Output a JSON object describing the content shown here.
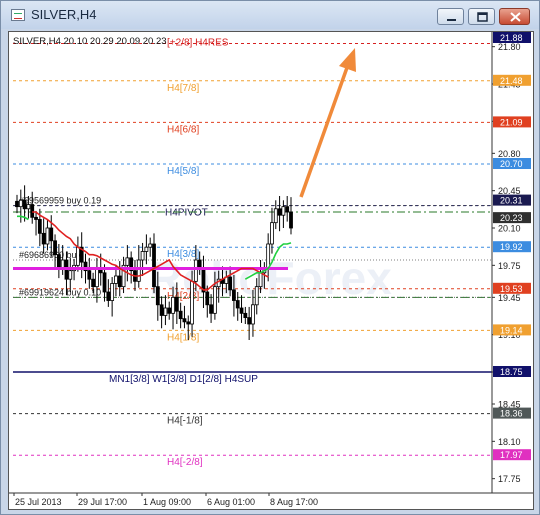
{
  "window": {
    "title": "SILVER,H4",
    "buttons": {
      "minimize": "minimize-icon",
      "maximize": "maximize-icon",
      "close": "close-icon"
    }
  },
  "chart_data": {
    "type": "candlestick",
    "symbol_header": "SILVER,H4  20.10 20.29 20.09 20.23",
    "ylim": [
      17.7,
      21.9
    ],
    "y_ticks": [
      "21.80",
      "21.45",
      "21.10",
      "20.80",
      "20.45",
      "20.10",
      "19.75",
      "19.45",
      "19.10",
      "18.75",
      "18.45",
      "18.10",
      "17.75"
    ],
    "x_ticks": [
      "25 Jul 2013",
      "29 Jul 17:00",
      "1 Aug 09:00",
      "6 Aug 01:00",
      "8 Aug 17:00"
    ],
    "watermark": "RoboForex",
    "levels": [
      {
        "label": "[+2/8] H4RES",
        "value": 21.83,
        "color": "#d62020",
        "style": "dash"
      },
      {
        "label": "H4[7/8]",
        "value": 21.48,
        "color": "#f0a030",
        "style": "dash"
      },
      {
        "label": "H4[6/8]",
        "value": 21.09,
        "color": "#e04020",
        "style": "dash"
      },
      {
        "label": "H4[5/8]",
        "value": 20.7,
        "color": "#3c8ce0",
        "style": "dash"
      },
      {
        "label": "H4PIVOT",
        "value": 20.31,
        "color": "#1a1a50",
        "style": "dash"
      },
      {
        "label": "H4[3/8]",
        "value": 19.92,
        "color": "#3c8ce0",
        "style": "dash"
      },
      {
        "label": "H4[2/8]",
        "value": 19.53,
        "color": "#e04020",
        "style": "dash"
      },
      {
        "label": "H4[1/8]",
        "value": 19.14,
        "color": "#f0a030",
        "style": "dash"
      },
      {
        "label": "MN1[3/8] W1[3/8] D1[2/8] H4SUP",
        "value": 18.75,
        "color": "#10106a",
        "style": "solid"
      },
      {
        "label": "H4[-1/8]",
        "value": 18.36,
        "color": "#333333",
        "style": "dash"
      },
      {
        "label": "H4[-2/8]",
        "value": 17.97,
        "color": "#e030c0",
        "style": "dash"
      }
    ],
    "price_badges": [
      {
        "text": "21.88",
        "color": "#10106a"
      },
      {
        "text": "21.48",
        "color": "#f0a030"
      },
      {
        "text": "21.09",
        "color": "#e04020"
      },
      {
        "text": "20.70",
        "color": "#3c8ce0"
      },
      {
        "text": "20.31",
        "color": "#1a1a50"
      },
      {
        "text": "20.23",
        "color": "#303030"
      },
      {
        "text": "19.92",
        "color": "#3c8ce0"
      },
      {
        "text": "19.53",
        "color": "#e04020"
      },
      {
        "text": "19.14",
        "color": "#f0a030"
      },
      {
        "text": "18.75",
        "color": "#10106a"
      },
      {
        "text": "18.36",
        "color": "#505858"
      },
      {
        "text": "17.97",
        "color": "#e030c0"
      }
    ],
    "orders": [
      {
        "label": "#69569959 buy 0.19",
        "value": 20.31
      },
      {
        "label": "#69686960 buy",
        "value": 19.8
      },
      {
        "label": "#69919624 buy 0.10",
        "value": 19.45
      }
    ],
    "magenta_level": 19.72,
    "dashdot_levels": [
      20.25,
      19.45
    ],
    "close_series": [
      20.3,
      20.36,
      20.28,
      20.32,
      20.2,
      20.18,
      20.05,
      19.95,
      20.1,
      19.98,
      19.85,
      19.72,
      19.8,
      19.62,
      19.7,
      19.75,
      19.92,
      19.78,
      19.7,
      19.62,
      19.55,
      19.72,
      19.68,
      19.5,
      19.42,
      19.58,
      19.65,
      19.55,
      19.75,
      19.82,
      19.7,
      19.6,
      19.8,
      19.88,
      19.92,
      19.95,
      19.55,
      19.38,
      19.28,
      19.35,
      19.3,
      19.45,
      19.32,
      19.25,
      19.22,
      19.2,
      19.6,
      19.8,
      19.72,
      19.5,
      19.38,
      19.3,
      19.55,
      19.62,
      19.58,
      19.64,
      19.52,
      19.42,
      19.35,
      19.3,
      19.26,
      19.2,
      19.38,
      19.55,
      19.68,
      19.72,
      19.95,
      20.15,
      20.28,
      20.22,
      20.3,
      20.25,
      20.1
    ],
    "red_line": [
      20.25,
      20.25,
      20.22,
      20.2,
      20.18,
      20.15,
      20.12,
      20.08,
      20.05,
      20.02,
      20.0,
      19.95,
      19.92,
      19.9,
      19.88,
      19.85,
      19.85,
      19.84,
      19.82,
      19.8,
      19.78,
      19.76,
      19.75,
      19.72,
      19.7,
      19.68,
      19.66,
      19.65,
      19.65,
      19.66,
      19.68,
      19.7,
      19.72,
      19.74,
      19.76,
      19.78,
      19.8,
      19.74,
      19.7,
      19.66,
      19.64,
      19.62,
      19.6,
      19.58,
      19.55,
      19.52,
      19.52,
      19.55,
      19.58,
      19.6,
      19.62,
      19.64,
      19.66,
      19.68,
      19.7,
      19.72,
      19.72,
      19.72,
      19.72,
      19.7,
      19.68,
      19.66,
      19.64
    ],
    "green_line": [
      19.62,
      19.64,
      19.66,
      19.68,
      19.68,
      19.7,
      19.72,
      19.78,
      19.86,
      19.92,
      19.95,
      19.95,
      19.96
    ]
  }
}
